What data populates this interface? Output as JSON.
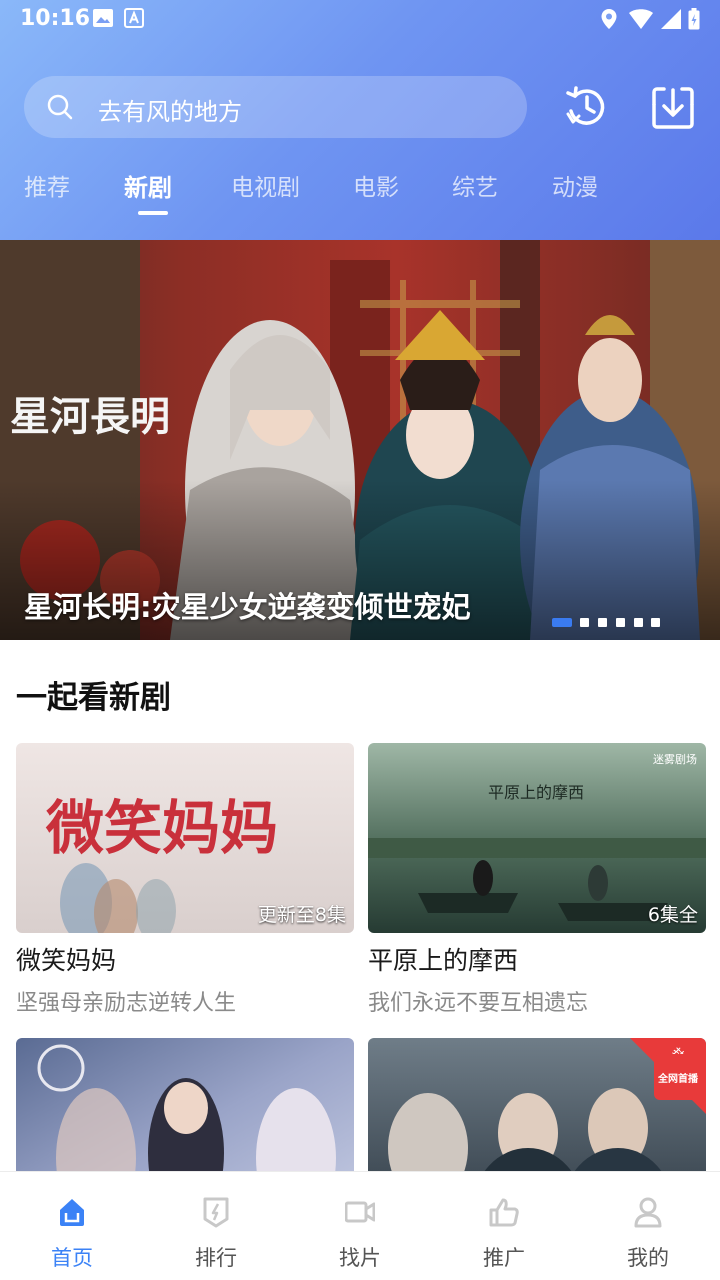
{
  "status_bar": {
    "time": "10:16"
  },
  "search": {
    "placeholder": "去有风的地方"
  },
  "header_buttons": [
    {
      "icon": "history-icon"
    },
    {
      "icon": "download-icon"
    }
  ],
  "tabs": [
    {
      "label": "推荐",
      "active": false
    },
    {
      "label": "新剧",
      "active": true
    },
    {
      "label": "电视剧",
      "active": false
    },
    {
      "label": "电影",
      "active": false
    },
    {
      "label": "综艺",
      "active": false
    },
    {
      "label": "动漫",
      "active": false
    }
  ],
  "banner": {
    "title": "星河长明:灾星少女逆袭变倾世宠妃",
    "poster_text": "星河長明",
    "slide_count": 6,
    "active_slide": 1
  },
  "section": {
    "title": "一起看新剧"
  },
  "cards": [
    {
      "title": "微笑妈妈",
      "subtitle": "坚强母亲励志逆转人生",
      "badge": "更新至8集",
      "poster_text": "微笑妈妈"
    },
    {
      "title": "平原上的摩西",
      "subtitle": "我们永远不要互相遗忘",
      "badge": "6集全",
      "poster_text": "平原上的摩西",
      "logo_text": "迷雾剧场"
    },
    {
      "title": "",
      "subtitle": "",
      "badge": ""
    },
    {
      "title": "",
      "subtitle": "",
      "badge": "",
      "corner_tag": "热播",
      "corner_tag2": "全网首播"
    }
  ],
  "bottom_nav": [
    {
      "label": "首页",
      "icon": "home-icon",
      "active": true
    },
    {
      "label": "排行",
      "icon": "ranking-icon",
      "active": false
    },
    {
      "label": "找片",
      "icon": "video-camera-icon",
      "active": false
    },
    {
      "label": "推广",
      "icon": "thumbs-up-icon",
      "active": false
    },
    {
      "label": "我的",
      "icon": "user-icon",
      "active": false
    }
  ],
  "colors": {
    "accent": "#3b82f6",
    "header_start": "#8ab8f9",
    "header_end": "#5b79ea"
  }
}
